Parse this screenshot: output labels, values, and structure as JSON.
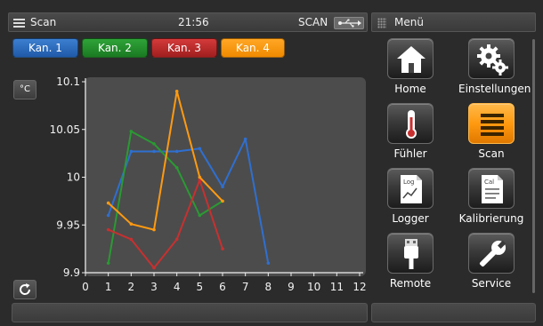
{
  "topbar": {
    "title": "Scan",
    "clock": "21:56",
    "scan_state": "SCAN"
  },
  "menu": {
    "title": "Menü",
    "items": [
      {
        "label": "Home",
        "icon": "home-icon",
        "active": false
      },
      {
        "label": "Einstellungen",
        "icon": "gears-icon",
        "active": false
      },
      {
        "label": "Fühler",
        "icon": "thermometer-icon",
        "active": false
      },
      {
        "label": "Scan",
        "icon": "scan-bars-icon",
        "active": true
      },
      {
        "label": "Logger",
        "icon": "log-document-icon",
        "active": false
      },
      {
        "label": "Kalibrierung",
        "icon": "cal-document-icon",
        "active": false
      },
      {
        "label": "Remote",
        "icon": "usb-plug-icon",
        "active": false
      },
      {
        "label": "Service",
        "icon": "wrench-icon",
        "active": false
      }
    ]
  },
  "channels": [
    {
      "label": "Kan. 1",
      "color": "#2f6fd0"
    },
    {
      "label": "Kan. 2",
      "color": "#2a9a33"
    },
    {
      "label": "Kan. 3",
      "color": "#c83030"
    },
    {
      "label": "Kan. 4",
      "color": "#ff9a10"
    }
  ],
  "unit_button": "°C",
  "refresh_button": "refresh-icon",
  "chart_data": {
    "type": "line",
    "x_ticks": [
      "0",
      "1",
      "2",
      "3",
      "4",
      "5",
      "6",
      "7",
      "8",
      "9",
      "10",
      "11",
      "12"
    ],
    "y_ticks": [
      "10.1",
      "10.05",
      "10",
      "9.95",
      "9.9"
    ],
    "xlim": [
      0,
      12
    ],
    "ylim": [
      9.9,
      10.1
    ],
    "grid": false,
    "series": [
      {
        "name": "Kan. 1",
        "color": "#2f6fd0",
        "x": [
          1,
          2,
          3,
          4,
          5,
          6,
          7,
          8
        ],
        "y": [
          9.96,
          10.027,
          10.027,
          10.027,
          10.03,
          9.99,
          10.04,
          9.91
        ]
      },
      {
        "name": "Kan. 2",
        "color": "#2a9a33",
        "x": [
          1,
          2,
          3,
          4,
          5,
          6
        ],
        "y": [
          9.91,
          10.048,
          10.035,
          10.01,
          9.96,
          9.975
        ]
      },
      {
        "name": "Kan. 3",
        "color": "#c83030",
        "x": [
          1,
          2,
          3,
          4,
          5,
          6
        ],
        "y": [
          9.945,
          9.935,
          9.905,
          9.935,
          9.997,
          9.925
        ]
      },
      {
        "name": "Kan. 4",
        "color": "#ff9a10",
        "x": [
          1,
          2,
          3,
          4,
          5,
          6
        ],
        "y": [
          9.973,
          9.951,
          9.945,
          10.09,
          10.0,
          9.975
        ]
      }
    ]
  }
}
